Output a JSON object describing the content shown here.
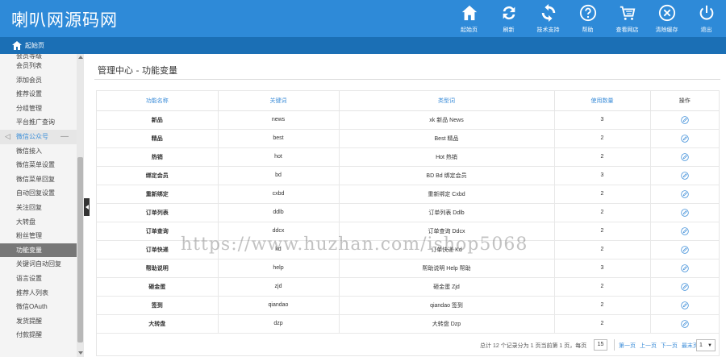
{
  "header": {
    "logo": "喇叭网源码网",
    "tools": [
      {
        "label": "起始页",
        "icon": "home-icon"
      },
      {
        "label": "刷新",
        "icon": "refresh-icon"
      },
      {
        "label": "技术支持",
        "icon": "sync-icon"
      },
      {
        "label": "帮助",
        "icon": "help-icon"
      },
      {
        "label": "查看网店",
        "icon": "cart-icon"
      },
      {
        "label": "清除缓存",
        "icon": "clear-cache-icon"
      },
      {
        "label": "退出",
        "icon": "power-icon"
      }
    ]
  },
  "navbar": {
    "home_label": "起始页"
  },
  "sidebar": {
    "items": [
      {
        "label": "会员等级",
        "type": "partial"
      },
      {
        "label": "会员列表",
        "type": "item"
      },
      {
        "label": "添加会员",
        "type": "item"
      },
      {
        "label": "推荐设置",
        "type": "item"
      },
      {
        "label": "分组管理",
        "type": "item"
      },
      {
        "label": "平台推广查询",
        "type": "item"
      },
      {
        "label": "微信公众号",
        "type": "group"
      },
      {
        "label": "微信接入",
        "type": "item"
      },
      {
        "label": "微信菜单设置",
        "type": "item"
      },
      {
        "label": "微信菜单回复",
        "type": "item"
      },
      {
        "label": "自动回复设置",
        "type": "item"
      },
      {
        "label": "关注回复",
        "type": "item"
      },
      {
        "label": "大转盘",
        "type": "item"
      },
      {
        "label": "粉丝管理",
        "type": "item"
      },
      {
        "label": "功能变量",
        "type": "active"
      },
      {
        "label": "关键词自动回复",
        "type": "item"
      },
      {
        "label": "语言设置",
        "type": "item"
      },
      {
        "label": "推荐人列表",
        "type": "item"
      },
      {
        "label": "微信OAuth",
        "type": "item"
      },
      {
        "label": "发货提醒",
        "type": "item"
      },
      {
        "label": "付款提醒",
        "type": "item"
      }
    ]
  },
  "main": {
    "title": "管理中心 - 功能变量",
    "table": {
      "headers": [
        "功能名称",
        "关键词",
        "类型词",
        "使用数量",
        "操作"
      ],
      "rows": [
        [
          "新品",
          "news",
          "xk 新品 News",
          "3"
        ],
        [
          "精品",
          "best",
          "Best 精品",
          "2"
        ],
        [
          "热销",
          "hot",
          "Hot 热销",
          "2"
        ],
        [
          "绑定会员",
          "bd",
          "BD Bd 绑定会员",
          "3"
        ],
        [
          "重新绑定",
          "cxbd",
          "重新绑定 Cxbd",
          "2"
        ],
        [
          "订单列表",
          "ddlb",
          "订单列表 Ddlb",
          "2"
        ],
        [
          "订单查询",
          "ddcx",
          "订单查询 Ddcx",
          "2"
        ],
        [
          "订单快递",
          "kd",
          "订单快递 Kd",
          "2"
        ],
        [
          "帮助说明",
          "help",
          "帮助说明 Help 帮助",
          "3"
        ],
        [
          "砸金蛋",
          "zjd",
          "砸金蛋 Zjd",
          "2"
        ],
        [
          "签到",
          "qiandao",
          "qiandao 签到",
          "2"
        ],
        [
          "大转盘",
          "dzp",
          "大转盘 Dzp",
          "2"
        ]
      ]
    },
    "pager": {
      "info": "总计 12 个记录分为 1 页当前第 1 页，每页",
      "per_page": "15",
      "first": "第一页",
      "prev": "上一页",
      "next": "下一页",
      "last": "最末页",
      "page_select": "1"
    },
    "watermark": "https://www.huzhan.com/ishop5068"
  },
  "colors": {
    "header": "#2e8ad8",
    "navbar": "#1b6fb5",
    "accent": "#3c8dd8",
    "active_item": "#777777"
  }
}
